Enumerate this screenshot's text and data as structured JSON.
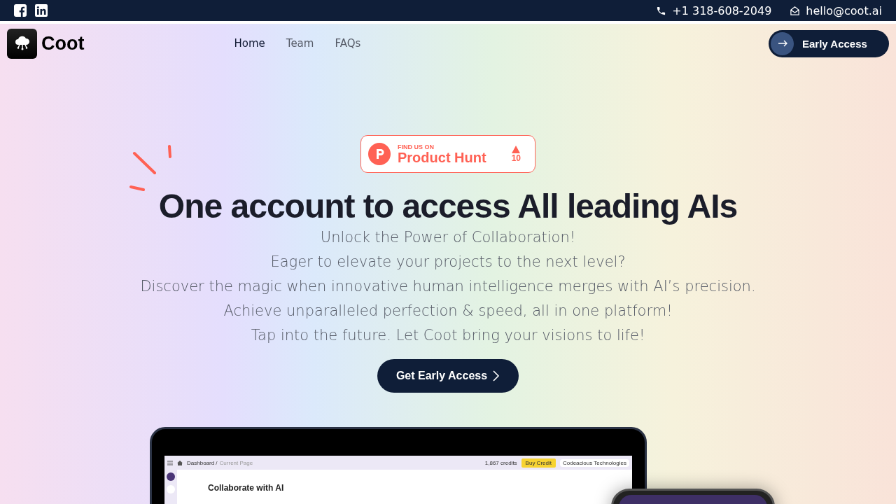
{
  "top_bar": {
    "phone": "+1 318-608-2049",
    "email": "hello@coot.ai"
  },
  "nav": {
    "brand": "Coot",
    "links": [
      {
        "label": "Home",
        "selected": true
      },
      {
        "label": "Team",
        "selected": false
      },
      {
        "label": "FAQs",
        "selected": false
      }
    ],
    "cta": "Early Access"
  },
  "product_hunt": {
    "eyebrow": "FIND US ON",
    "name": "Product Hunt",
    "votes": "10"
  },
  "hero": {
    "title": "One account to access All leading AIs",
    "lines": [
      "Unlock the Power of Collaboration!",
      "Eager to elevate your projects to the next level?",
      "Discover the magic when innovative human intelligence merges with AI’s precision.",
      "Achieve unparalleled perfection & speed, all in one platform!",
      "Tap into the future. Let Coot bring your visions to life!"
    ],
    "button": "Get Early Access"
  },
  "app_preview": {
    "breadcrumb": "Dashboard /",
    "current": "Current Page",
    "credits": "1,867 credits",
    "buy": "Buy Credit",
    "workspace": "Codeacious Technologies",
    "heading": "Collaborate with AI"
  }
}
